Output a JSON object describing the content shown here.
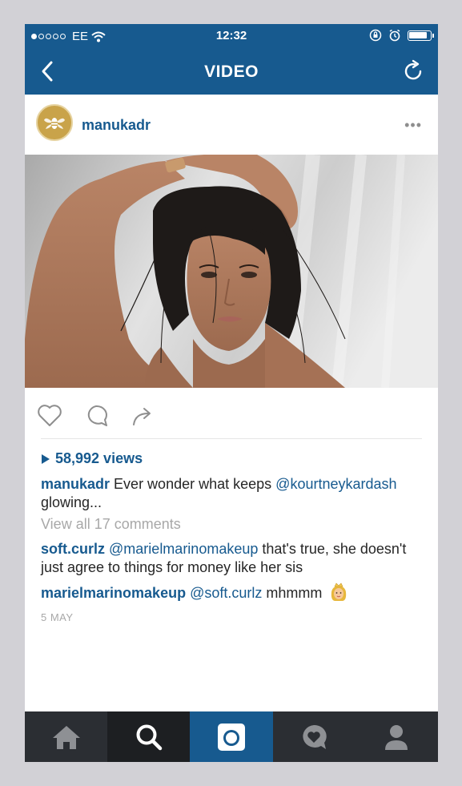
{
  "statusbar": {
    "carrier": "EE",
    "time": "12:32"
  },
  "navbar": {
    "title": "VIDEO",
    "back_icon": "chevron-left-icon",
    "refresh_icon": "refresh-icon"
  },
  "post": {
    "username": "manukadr",
    "more_label": "•••",
    "views": "58,992 views",
    "caption_user": "manukadr",
    "caption_text_1": "Ever wonder what keeps",
    "caption_mention": "@kourtneykardash",
    "caption_text_2": "glowing...",
    "view_all": "View all 17 comments",
    "comments": [
      {
        "user": "soft.curlz",
        "mention": "@marielmarinomakeup",
        "text": "that's true, she doesn't just agree to things for money like her sis"
      },
      {
        "user": "marielmarinomakeup",
        "mention": "@soft.curlz",
        "text": "mhmmm"
      }
    ],
    "date": "5 MAY"
  },
  "tabbar": {
    "tabs": [
      "home-icon",
      "search-icon",
      "camera-icon",
      "activity-icon",
      "profile-icon"
    ]
  },
  "colors": {
    "brand": "#175a8f",
    "tabbar": "#2b2e33"
  }
}
